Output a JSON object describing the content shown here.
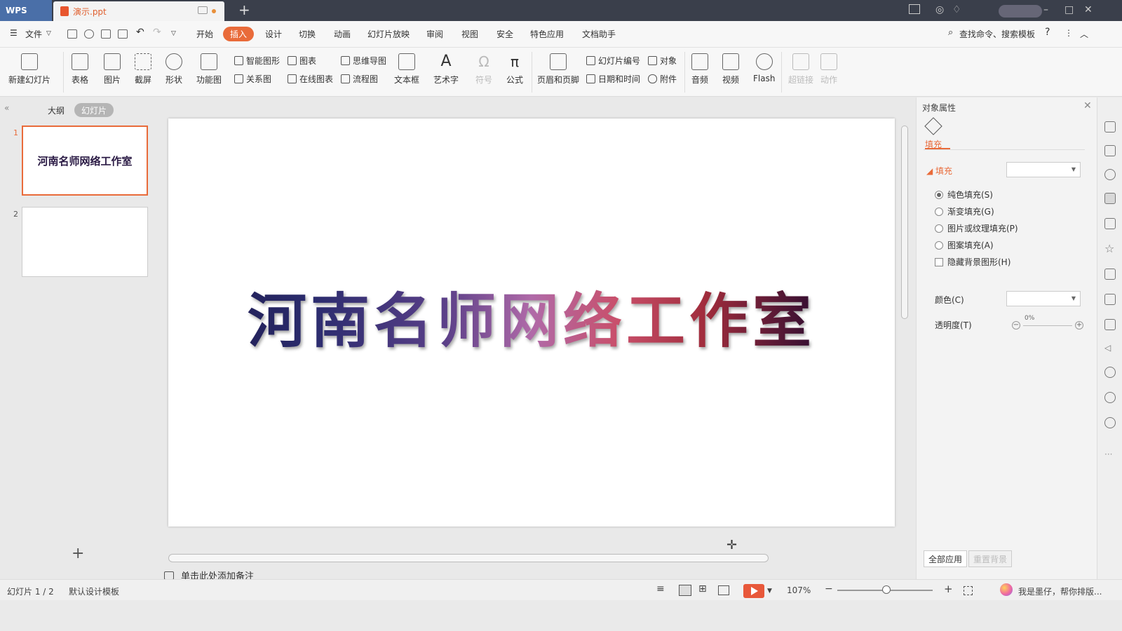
{
  "titlebar": {
    "app": "WPS",
    "doc_tab": "演示.ppt",
    "new_tab": "+"
  },
  "menu": {
    "file": "文件",
    "items": [
      "开始",
      "插入",
      "设计",
      "切换",
      "动画",
      "幻灯片放映",
      "审阅",
      "视图",
      "安全",
      "特色应用",
      "文档助手"
    ],
    "active": "插入",
    "search": "查找命令、搜索模板",
    "help": "?"
  },
  "ribbon": {
    "new_slide": "新建幻灯片",
    "table": "表格",
    "picture": "图片",
    "screenshot": "截屏",
    "shape": "形状",
    "function_chart": "功能图",
    "smart_shape": "智能图形",
    "chart": "图表",
    "relation": "关系图",
    "online_chart": "在线图表",
    "mindmap": "思维导图",
    "flowchart": "流程图",
    "textbox": "文本框",
    "wordart": "艺术字",
    "symbol": "符号",
    "formula": "公式",
    "header_footer": "页眉和页脚",
    "slide_number": "幻灯片编号",
    "object": "对象",
    "datetime": "日期和时间",
    "attachment": "附件",
    "audio": "音频",
    "video": "视频",
    "flash": "Flash",
    "hyperlink": "超链接",
    "action": "动作"
  },
  "left": {
    "tab_outline": "大纲",
    "tab_slides": "幻灯片",
    "thumb1_text": "河南名师网络工作室",
    "num1": "1",
    "num2": "2",
    "add": "+"
  },
  "slide": {
    "title": "河南名师网络工作室"
  },
  "notes": {
    "placeholder": "单击此处添加备注"
  },
  "props": {
    "title": "对象属性",
    "fill_tab": "填充",
    "section": "填充",
    "options": [
      "纯色填充(S)",
      "渐变填充(G)",
      "图片或纹理填充(P)",
      "图案填充(A)"
    ],
    "hide_bg": "隐藏背景图形(H)",
    "color_label": "颜色(C)",
    "transparency_label": "透明度(T)",
    "transparency_value": "0%",
    "apply_all": "全部应用",
    "reset_bg": "重置背景"
  },
  "status": {
    "slide_pos": "幻灯片 1 / 2",
    "template": "默认设计模板",
    "zoom": "107%",
    "assistant": "我是墨仔，帮你排版..."
  },
  "colors": {
    "accent": "#e96b3a",
    "titlebar": "#3a3f4b"
  }
}
